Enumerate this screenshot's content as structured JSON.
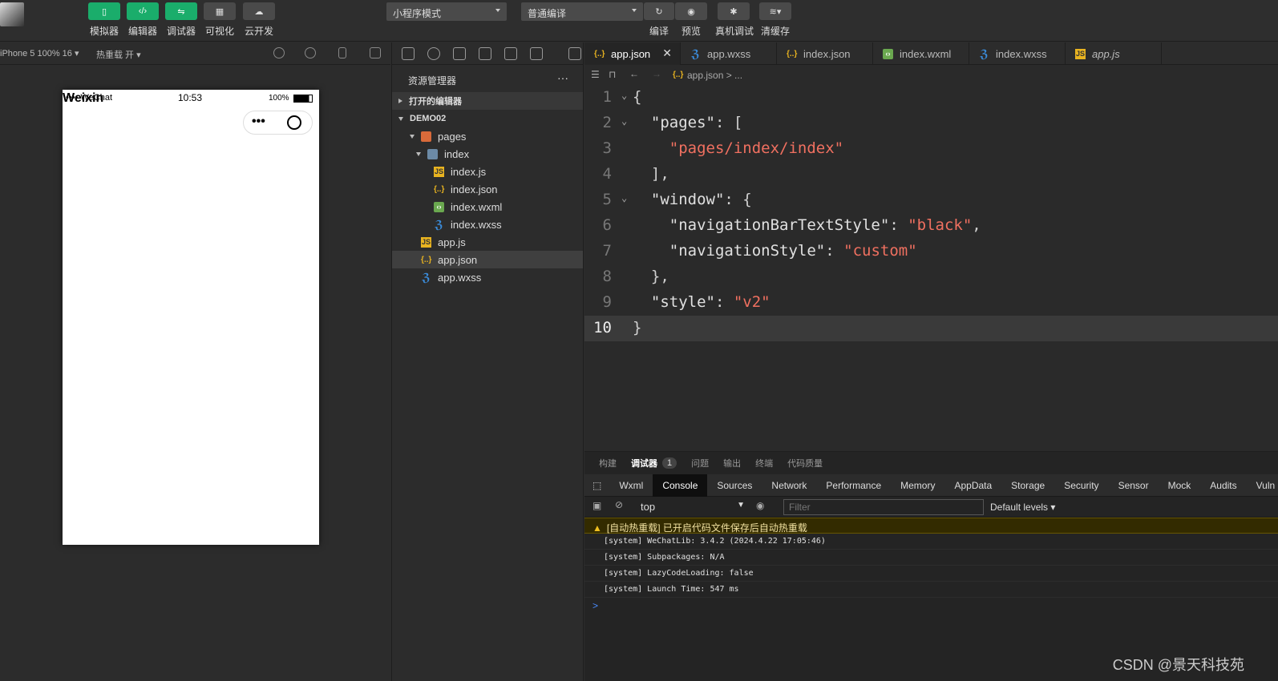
{
  "toolbar": {
    "buttons": [
      {
        "label": "模拟器",
        "icon": "phone-icon"
      },
      {
        "label": "编辑器",
        "icon": "code-icon"
      },
      {
        "label": "调试器",
        "icon": "debug-icon"
      },
      {
        "label": "可视化",
        "icon": "layout-icon"
      },
      {
        "label": "云开发",
        "icon": "cloud-icon"
      }
    ],
    "mode_select": "小程序模式",
    "compile_select": "普通编译",
    "right_buttons": [
      {
        "label": "编译",
        "icon": "refresh-icon"
      },
      {
        "label": "预览",
        "icon": "eye-icon"
      },
      {
        "label": "真机调试",
        "icon": "bug-icon"
      },
      {
        "label": "清缓存",
        "icon": "layers-icon"
      }
    ]
  },
  "simulator": {
    "device": "iPhone 5 100% 16 ▾",
    "hot_reload": "热重载 开 ▾",
    "status_carrier": "•••• WeChat",
    "status_time": "10:53",
    "status_battery": "100%",
    "page_title": "Weixin"
  },
  "explorer": {
    "header": "资源管理器",
    "more": "···",
    "open_editors": "打开的编辑器",
    "project": "DEMO02",
    "items": {
      "pages": "pages",
      "index": "index",
      "index_js": "index.js",
      "index_json": "index.json",
      "index_wxml": "index.wxml",
      "index_wxss": "index.wxss",
      "app_js": "app.js",
      "app_json": "app.json",
      "app_wxss": "app.wxss"
    }
  },
  "editor": {
    "tabs": [
      "app.json",
      "app.wxss",
      "index.json",
      "index.wxml",
      "index.wxss",
      "app.js"
    ],
    "breadcrumb": "app.json > ...",
    "line_numbers": [
      "1",
      "2",
      "3",
      "4",
      "5",
      "6",
      "7",
      "8",
      "9",
      "10"
    ]
  },
  "panel": {
    "tabs": [
      "构建",
      "调试器",
      "问题",
      "输出",
      "终端",
      "代码质量"
    ],
    "badge": "1",
    "devtools_tabs": [
      "Wxml",
      "Console",
      "Sources",
      "Network",
      "Performance",
      "Memory",
      "AppData",
      "Storage",
      "Security",
      "Sensor",
      "Mock",
      "Audits",
      "Vuln"
    ],
    "context": "top",
    "filter_placeholder": "Filter",
    "levels": "Default levels ▾",
    "warning": "[自动热重载] 已开启代码文件保存后自动热重载",
    "logs": [
      "[system] WeChatLib: 3.4.2 (2024.4.22 17:05:46)",
      "[system] Subpackages: N/A",
      "[system] LazyCodeLoading: false",
      "[system] Launch Time: 547 ms"
    ],
    "prompt": ">"
  },
  "watermark": "CSDN @景天科技苑"
}
